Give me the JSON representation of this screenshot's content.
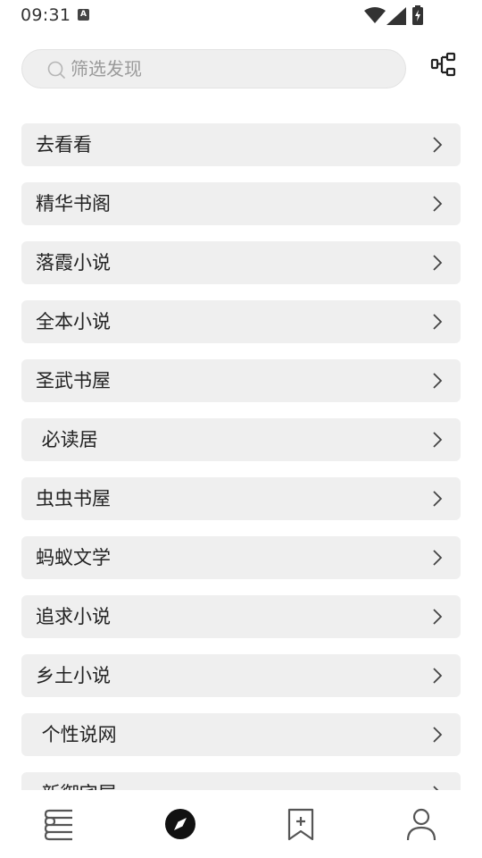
{
  "status_bar": {
    "time": "09:31",
    "notification_icon": "A"
  },
  "search": {
    "placeholder": "筛选发现",
    "value": ""
  },
  "list": {
    "items": [
      {
        "label": "去看看"
      },
      {
        "label": "精华书阁"
      },
      {
        "label": "落霞小说"
      },
      {
        "label": "全本小说"
      },
      {
        "label": "圣武书屋"
      },
      {
        "label": " 必读居"
      },
      {
        "label": "虫虫书屋"
      },
      {
        "label": "蚂蚁文学"
      },
      {
        "label": "追求小说"
      },
      {
        "label": "乡土小说"
      },
      {
        "label": " 个性说网"
      },
      {
        "label": " 新御宅屋"
      }
    ]
  },
  "bottom_nav": {
    "items": [
      {
        "name": "bookshelf-icon",
        "active": false
      },
      {
        "name": "compass-icon",
        "active": true
      },
      {
        "name": "bookmark-add-icon",
        "active": false
      },
      {
        "name": "user-icon",
        "active": false
      }
    ]
  },
  "colors": {
    "item_bg": "#efefef",
    "active_icon": "#111111",
    "inactive_icon": "#666666"
  }
}
